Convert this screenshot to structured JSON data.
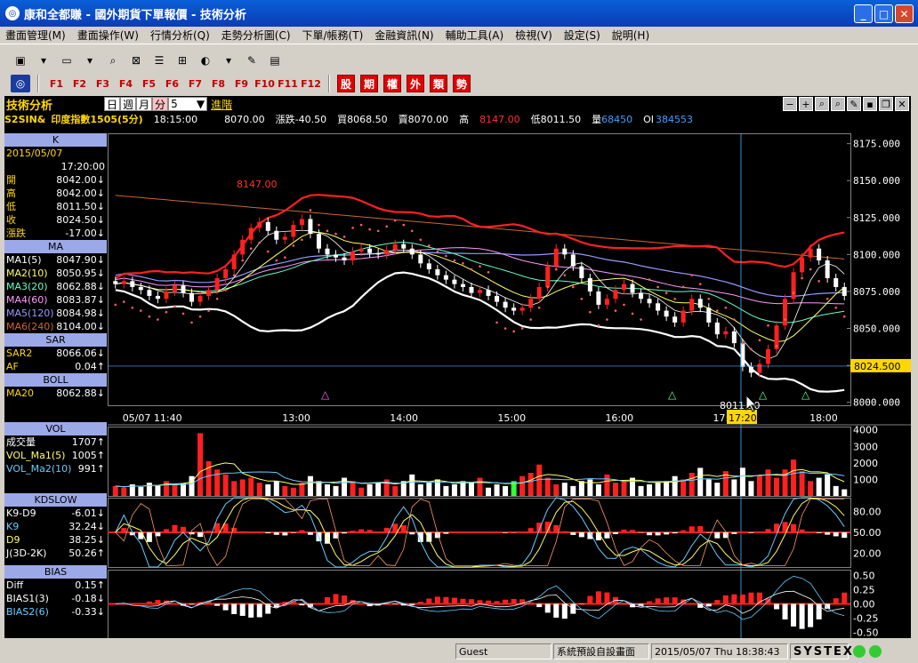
{
  "window": {
    "title": "康和全都賺 - 國外期貨下單報價 - 技術分析"
  },
  "menu": [
    "畫面管理(M)",
    "畫面操作(W)",
    "行情分析(Q)",
    "走勢分析圖(C)",
    "下單/帳務(T)",
    "金融資訊(N)",
    "輔助工具(A)",
    "檢視(V)",
    "設定(S)",
    "說明(H)"
  ],
  "fkeys": [
    "F1",
    "F2",
    "F3",
    "F4",
    "F5",
    "F6",
    "F7",
    "F8",
    "F9",
    "F10",
    "F11",
    "F12"
  ],
  "category_buttons": [
    "股",
    "期",
    "權",
    "外",
    "類",
    "勢"
  ],
  "panel": {
    "name": "技術分析",
    "periods": [
      "日",
      "週",
      "月",
      "分"
    ],
    "active_period": "分",
    "interval": "5",
    "advance": "進階"
  },
  "quote": {
    "symbol": "S2SIN&",
    "name": "印度指數1505(5分)",
    "time": "18:15:00",
    "last": "8070.00",
    "change": "漲跌-40.50",
    "bid": "買8068.50",
    "ask": "賣8070.00",
    "high_label": "高",
    "high": "8147.00",
    "low": "低8011.50",
    "vol_label": "量",
    "vol": "68450",
    "oi_label": "OI",
    "oi": "384553"
  },
  "info": {
    "k_title": "K",
    "date": "2015/05/07",
    "time": "17:20:00",
    "ohlc": [
      {
        "label": "開",
        "value": "8042.00↓"
      },
      {
        "label": "高",
        "value": "8042.00↓"
      },
      {
        "label": "低",
        "value": "8011.50↓"
      },
      {
        "label": "收",
        "value": "8024.50↓"
      },
      {
        "label": "漲跌",
        "value": "-17.00↓"
      }
    ],
    "ma_title": "MA",
    "ma": [
      {
        "label": "MA1(5)",
        "value": "8047.90↓",
        "color": "#ffffff"
      },
      {
        "label": "MA2(10)",
        "value": "8050.95↓",
        "color": "#ffff66"
      },
      {
        "label": "MA3(20)",
        "value": "8062.88↓",
        "color": "#66ffcc"
      },
      {
        "label": "MA4(60)",
        "value": "8083.87↓",
        "color": "#ff99ff"
      },
      {
        "label": "MA5(120)",
        "value": "8084.98↓",
        "color": "#9999ff"
      },
      {
        "label": "MA6(240)",
        "value": "8104.00↓",
        "color": "#cc6633"
      }
    ],
    "sar_title": "SAR",
    "sar": [
      {
        "label": "SAR2",
        "value": "8066.06↓"
      },
      {
        "label": "AF",
        "value": "0.04↑"
      }
    ],
    "boll_title": "BOLL",
    "boll": [
      {
        "label": "MA20",
        "value": "8062.88↓"
      }
    ],
    "vol_title": "VOL",
    "vol": [
      {
        "label": "成交量",
        "value": "1707↑",
        "color": "#ffffff"
      },
      {
        "label": "VOL_Ma1(5)",
        "value": "1005↑",
        "color": "#ffff66"
      },
      {
        "label": "VOL_Ma2(10)",
        "value": "991↑",
        "color": "#66ccff"
      }
    ],
    "kd_title": "KDSLOW",
    "kd": [
      {
        "label": "K9-D9",
        "value": "-6.01↓",
        "color": "#ffffff"
      },
      {
        "label": "K9",
        "value": "32.24↓",
        "color": "#66ccff"
      },
      {
        "label": "D9",
        "value": "38.25↓",
        "color": "#ffff66"
      },
      {
        "label": "J(3D-2K)",
        "value": "50.26↑",
        "color": "#ffffff"
      }
    ],
    "bias_title": "BIAS",
    "bias": [
      {
        "label": "Diff",
        "value": "0.15↑",
        "color": "#ffffff"
      },
      {
        "label": "BIAS1(3)",
        "value": "-0.18↓",
        "color": "#ffffff"
      },
      {
        "label": "BIAS2(6)",
        "value": "-0.33↓",
        "color": "#66ccff"
      }
    ]
  },
  "chart_data": {
    "type": "candlestick",
    "price_axis": {
      "ticks": [
        "8175.000",
        "8150.000",
        "8125.000",
        "8100.000",
        "8075.000",
        "8050.000",
        "8025.000",
        "8000.000"
      ],
      "range": [
        7998,
        8182
      ]
    },
    "time_axis": [
      "05/07 11:40",
      "13:00",
      "14:00",
      "15:00",
      "16:00",
      "17:00",
      "18:00"
    ],
    "cursor_time": "17:20",
    "cursor_price": "8024.500",
    "high_label": "8147.00",
    "low_label": "8011.50",
    "close": [
      8080,
      8082,
      8078,
      8076,
      8072,
      8070,
      8075,
      8079,
      8074,
      8068,
      8072,
      8076,
      8084,
      8090,
      8100,
      8110,
      8118,
      8122,
      8116,
      8110,
      8112,
      8120,
      8124,
      8114,
      8104,
      8100,
      8098,
      8096,
      8102,
      8104,
      8101,
      8100,
      8103,
      8107,
      8104,
      8100,
      8094,
      8090,
      8086,
      8083,
      8080,
      8078,
      8074,
      8076,
      8072,
      8068,
      8064,
      8062,
      8064,
      8070,
      8078,
      8092,
      8104,
      8100,
      8092,
      8084,
      8075,
      8066,
      8070,
      8076,
      8080,
      8074,
      8070,
      8067,
      8062,
      8058,
      8054,
      8062,
      8070,
      8064,
      8054,
      8046,
      8048,
      8040,
      8024,
      8020,
      8026,
      8036,
      8052,
      8070,
      8088,
      8098,
      8104,
      8096,
      8084,
      8078,
      8072
    ],
    "volume": [
      600,
      500,
      700,
      550,
      800,
      650,
      900,
      700,
      750,
      1200,
      3800,
      2100,
      1600,
      1300,
      900,
      1000,
      1100,
      800,
      700,
      900,
      600,
      500,
      800,
      1200,
      900,
      700,
      600,
      1100,
      900,
      500,
      700,
      800,
      1000,
      600,
      900,
      1300,
      700,
      800,
      1000,
      600,
      700,
      900,
      800,
      1100,
      500,
      700,
      600,
      900,
      1200,
      1400,
      1900,
      1100,
      700,
      800,
      600,
      900,
      1000,
      700,
      1300,
      800,
      900,
      1100,
      600,
      700,
      800,
      900,
      1200,
      1000,
      1400,
      1700,
      1000,
      800,
      1500,
      1000,
      1707,
      900,
      1200,
      1600,
      1100,
      1600,
      2200,
      1500,
      900,
      1100,
      1300,
      600,
      400
    ],
    "kd_range": [
      0,
      100
    ],
    "kd_ticks": [
      "80.00",
      "50.00",
      "20.00"
    ],
    "bias_ticks": [
      "0.50",
      "0.25",
      "0.00",
      "-0.25",
      "-0.50"
    ],
    "bias_range": [
      -0.6,
      0.6
    ],
    "vol_ticks": [
      "4000",
      "3000",
      "2000",
      "1000"
    ],
    "vol_range": [
      0,
      4200
    ]
  },
  "status": {
    "user": "Guest",
    "mode": "系統預設自設畫面",
    "datetime": "2015/05/07 Thu 18:38:43",
    "brand": "SYSTEX"
  }
}
